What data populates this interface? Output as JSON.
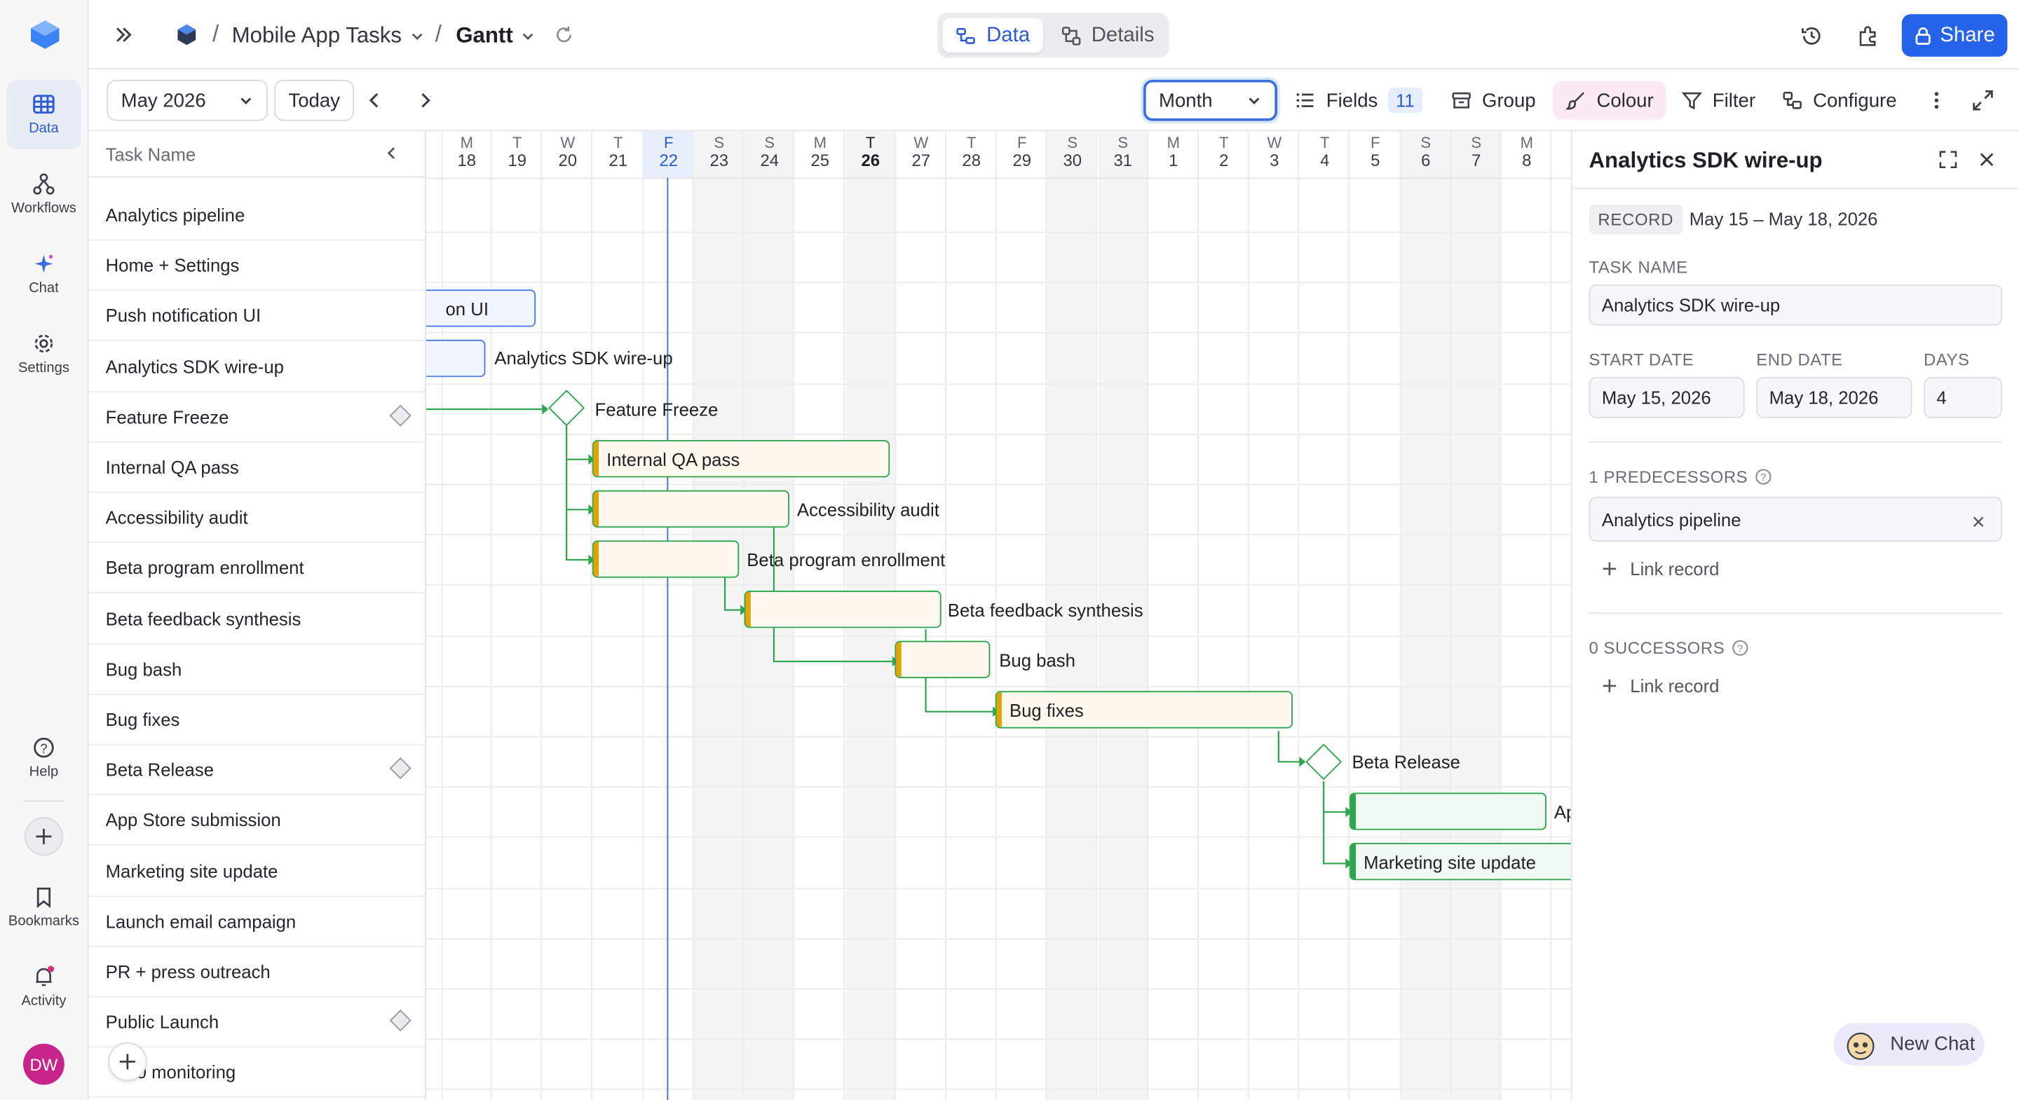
{
  "nav": {
    "items": [
      {
        "label": "Data",
        "icon": "table-icon"
      },
      {
        "label": "Workflows",
        "icon": "workflow-icon"
      },
      {
        "label": "Chat",
        "icon": "sparkle-icon"
      },
      {
        "label": "Settings",
        "icon": "gear-icon"
      }
    ],
    "help": "Help",
    "bookmarks": "Bookmarks",
    "activity": "Activity",
    "avatar": "DW"
  },
  "header": {
    "project": "Mobile App Tasks",
    "view": "Gantt",
    "toggle": {
      "data": "Data",
      "details": "Details"
    },
    "share": "Share"
  },
  "toolbar": {
    "month_picker": "May 2026",
    "today": "Today",
    "scale": "Month",
    "fields": "Fields",
    "fields_count": "11",
    "group": "Group",
    "colour": "Colour",
    "filter": "Filter",
    "configure": "Configure"
  },
  "tasks": {
    "header": "Task Name",
    "rows": [
      "Analytics pipeline",
      "Home + Settings",
      "Push notification UI",
      "Analytics SDK wire-up",
      "Feature Freeze",
      "Internal QA pass",
      "Accessibility audit",
      "Beta program enrollment",
      "Beta feedback synthesis",
      "Bug bash",
      "Bug fixes",
      "Beta Release",
      "App Store submission",
      "Marketing site update",
      "Launch email campaign",
      "PR + press outreach",
      "Public Launch",
      "0 monitoring"
    ]
  },
  "timeline": {
    "days": [
      {
        "d": "M",
        "n": "18"
      },
      {
        "d": "T",
        "n": "19"
      },
      {
        "d": "W",
        "n": "20"
      },
      {
        "d": "T",
        "n": "21"
      },
      {
        "d": "F",
        "n": "22"
      },
      {
        "d": "S",
        "n": "23"
      },
      {
        "d": "S",
        "n": "24"
      },
      {
        "d": "M",
        "n": "25"
      },
      {
        "d": "T",
        "n": "26"
      },
      {
        "d": "W",
        "n": "27"
      },
      {
        "d": "T",
        "n": "28"
      },
      {
        "d": "F",
        "n": "29"
      },
      {
        "d": "S",
        "n": "30"
      },
      {
        "d": "S",
        "n": "31"
      },
      {
        "d": "M",
        "n": "1"
      },
      {
        "d": "T",
        "n": "2"
      },
      {
        "d": "W",
        "n": "3"
      },
      {
        "d": "T",
        "n": "4"
      },
      {
        "d": "F",
        "n": "5"
      },
      {
        "d": "S",
        "n": "6"
      },
      {
        "d": "S",
        "n": "7"
      },
      {
        "d": "M",
        "n": "8"
      }
    ],
    "bar_labels": {
      "push": "on UI",
      "sdk": "Analytics SDK wire-up",
      "freeze": "Feature Freeze",
      "qa": "Internal QA pass",
      "a11y": "Accessibility audit",
      "beta_enroll": "Beta program enrollment",
      "beta_feedback": "Beta feedback synthesis",
      "bug_bash": "Bug bash",
      "bug_fixes": "Bug fixes",
      "beta_release": "Beta Release",
      "app_store": "Ap",
      "marketing": "Marketing site update"
    }
  },
  "panel": {
    "title": "Analytics SDK wire-up",
    "record_tag": "RECORD",
    "record_range": "May 15 – May 18, 2026",
    "task_name_label": "TASK NAME",
    "task_name": "Analytics SDK wire-up",
    "start_label": "START DATE",
    "start": "May 15, 2026",
    "end_label": "END DATE",
    "end": "May 18, 2026",
    "days_label": "DAYS",
    "days": "4",
    "pred_label": "1 PREDECESSORS",
    "predecessor": "Analytics pipeline",
    "link_record": "Link record",
    "succ_label": "0 SUCCESSORS"
  },
  "chat_button": "New Chat"
}
